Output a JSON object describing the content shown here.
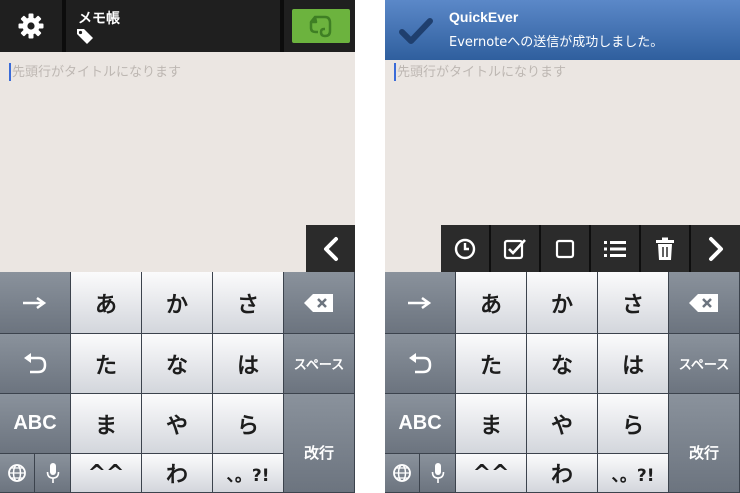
{
  "left_screen": {
    "header": {
      "settings_icon": "gear-icon",
      "note_title": "メモ帳",
      "tag_icon": "tag-icon",
      "evernote_icon": "evernote-elephant-icon",
      "evernote_color": "#6cb33e"
    },
    "editor": {
      "placeholder": "先頭行がタイトルになります"
    },
    "expand_icon": "chevron-left-icon"
  },
  "right_screen": {
    "notification": {
      "app_name": "QuickEver",
      "message": "Evernoteへの送信が成功しました。",
      "icon": "checkmark-icon"
    },
    "editor": {
      "placeholder": "先頭行がタイトルになります"
    },
    "toolbar": {
      "items": [
        "clock-icon",
        "checked-box-icon",
        "empty-box-icon",
        "list-icon",
        "trash-icon",
        "chevron-right-icon"
      ]
    }
  },
  "keyboard": {
    "row1": [
      "あ",
      "か",
      "さ"
    ],
    "row2": [
      "た",
      "な",
      "は"
    ],
    "row3": [
      "ま",
      "や",
      "ら"
    ],
    "row4": [
      "^^",
      "わ",
      "、。?!"
    ],
    "abc": "ABC",
    "space": "スペース",
    "enter": "改行",
    "icons": [
      "arrow-right-icon",
      "undo-icon",
      "backspace-icon",
      "globe-icon",
      "microphone-icon"
    ]
  }
}
